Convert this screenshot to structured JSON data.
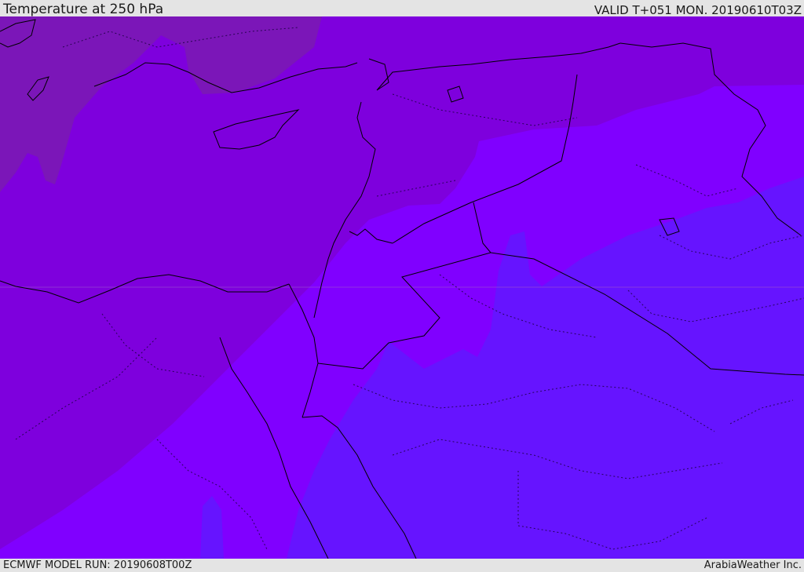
{
  "header": {
    "title": "Temperature at 250 hPa",
    "valid_time": "VALID T+051 MON. 20190610T03Z"
  },
  "footer": {
    "model_run": "ECMWF MODEL RUN: 20190608T00Z",
    "credit": "ArabiaWeather Inc."
  },
  "map": {
    "field": "temperature",
    "level": "250 hPa",
    "colors": {
      "darkest": "#7b16b8",
      "dark": "#7e00dd",
      "mid": "#8000ff",
      "light": "#6614ff",
      "border": "#000000"
    }
  }
}
